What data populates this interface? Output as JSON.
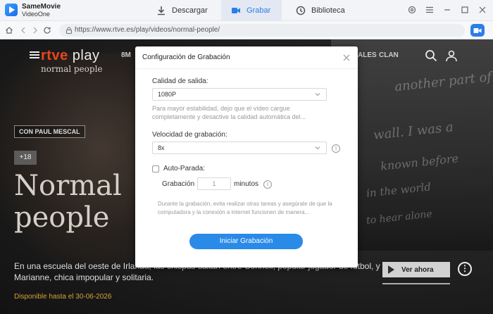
{
  "app": {
    "name": "SameMovie",
    "subtitle": "VideoOne"
  },
  "tabs": [
    {
      "label": "Descargar",
      "icon": "download-icon",
      "active": false
    },
    {
      "label": "Grabar",
      "icon": "record-icon",
      "active": true
    },
    {
      "label": "Biblioteca",
      "icon": "library-icon",
      "active": false
    }
  ],
  "window_icons": [
    "settings-icon",
    "menu-icon",
    "minimize-icon",
    "maximize-icon",
    "close-icon"
  ],
  "address": {
    "url": "https://www.rtve.es/play/videos/normal-people/"
  },
  "page": {
    "logo_brand": "rtve",
    "logo_suffix": "play",
    "show_name": "normal people",
    "nav_8m": "8M",
    "nav_right": [
      "ALES",
      "CLAN"
    ],
    "tag": "CON PAUL MESCAL",
    "age": "+18",
    "title": "Normal people",
    "description": "En una escuela del oeste de Irlanda, las chispas saltan entre Connell, popular jugador de fútbol, y Marianne, chica impopular y solitaria.",
    "available": "Disponible hasta el 30-06-2026",
    "watch_button": "Ver ahora",
    "background_script": [
      "another part of",
      "wall. I was a",
      "known before",
      "in the world",
      "to hear alone"
    ]
  },
  "dialog": {
    "title": "Configuración de Grabación",
    "quality_label": "Calidad de salida:",
    "quality_value": "1080P",
    "quality_hint": "Para mayor estabilidad, dejo que el vídeo cargue completamente y desactive la calidad automática del...",
    "speed_label": "Velocidad de grabación:",
    "speed_value": "8x",
    "autostop_label": "Auto-Parada:",
    "autostop_checked": false,
    "recording_label": "Grabación",
    "recording_value": "1",
    "minutes_label": "minutos",
    "note": "Durante la grabación, evita realizar otras tareas y asegúrate de que la computadora y la conexión a internet funcionen de manera...",
    "start_button": "Iniciar Grabación"
  },
  "colors": {
    "accent": "#2b7de9",
    "rtve_orange": "#ff4b1f",
    "available_yellow": "#e6b53c"
  }
}
